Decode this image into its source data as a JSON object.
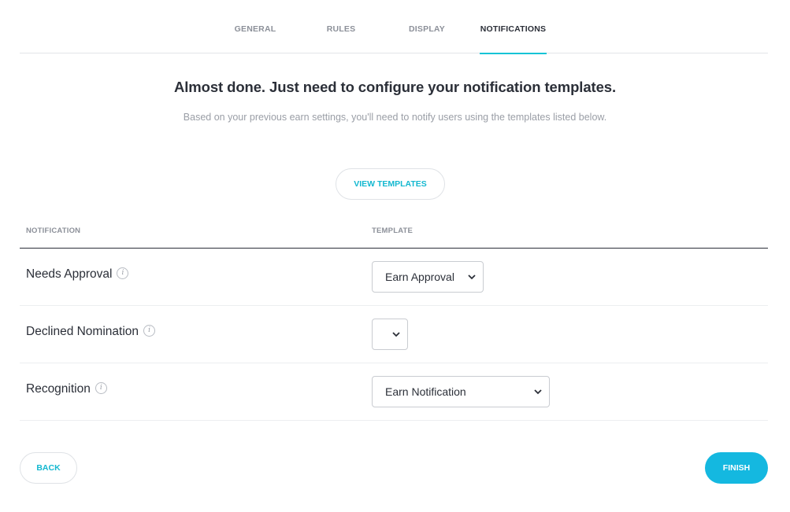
{
  "tabs": [
    {
      "label": "GENERAL",
      "active": false
    },
    {
      "label": "RULES",
      "active": false
    },
    {
      "label": "DISPLAY",
      "active": false
    },
    {
      "label": "NOTIFICATIONS",
      "active": true
    }
  ],
  "heading": "Almost done. Just need to configure your notification templates.",
  "subheading": "Based on your previous earn settings, you'll need to notify users using the templates listed below.",
  "view_templates_label": "VIEW TEMPLATES",
  "table": {
    "headers": {
      "notification": "NOTIFICATION",
      "template": "TEMPLATE"
    },
    "rows": [
      {
        "name": "Needs Approval",
        "template": "Earn Approval"
      },
      {
        "name": "Declined Nomination",
        "template": ""
      },
      {
        "name": "Recognition",
        "template": "Earn Notification"
      }
    ]
  },
  "footer": {
    "back_label": "BACK",
    "finish_label": "FINISH"
  },
  "icons": {
    "info": "info-icon",
    "dropdown": "chevron-down-icon"
  },
  "colors": {
    "accent": "#14b8d0",
    "finish_bg": "#14b8e0",
    "active_tab_underline": "#14c4d6"
  }
}
